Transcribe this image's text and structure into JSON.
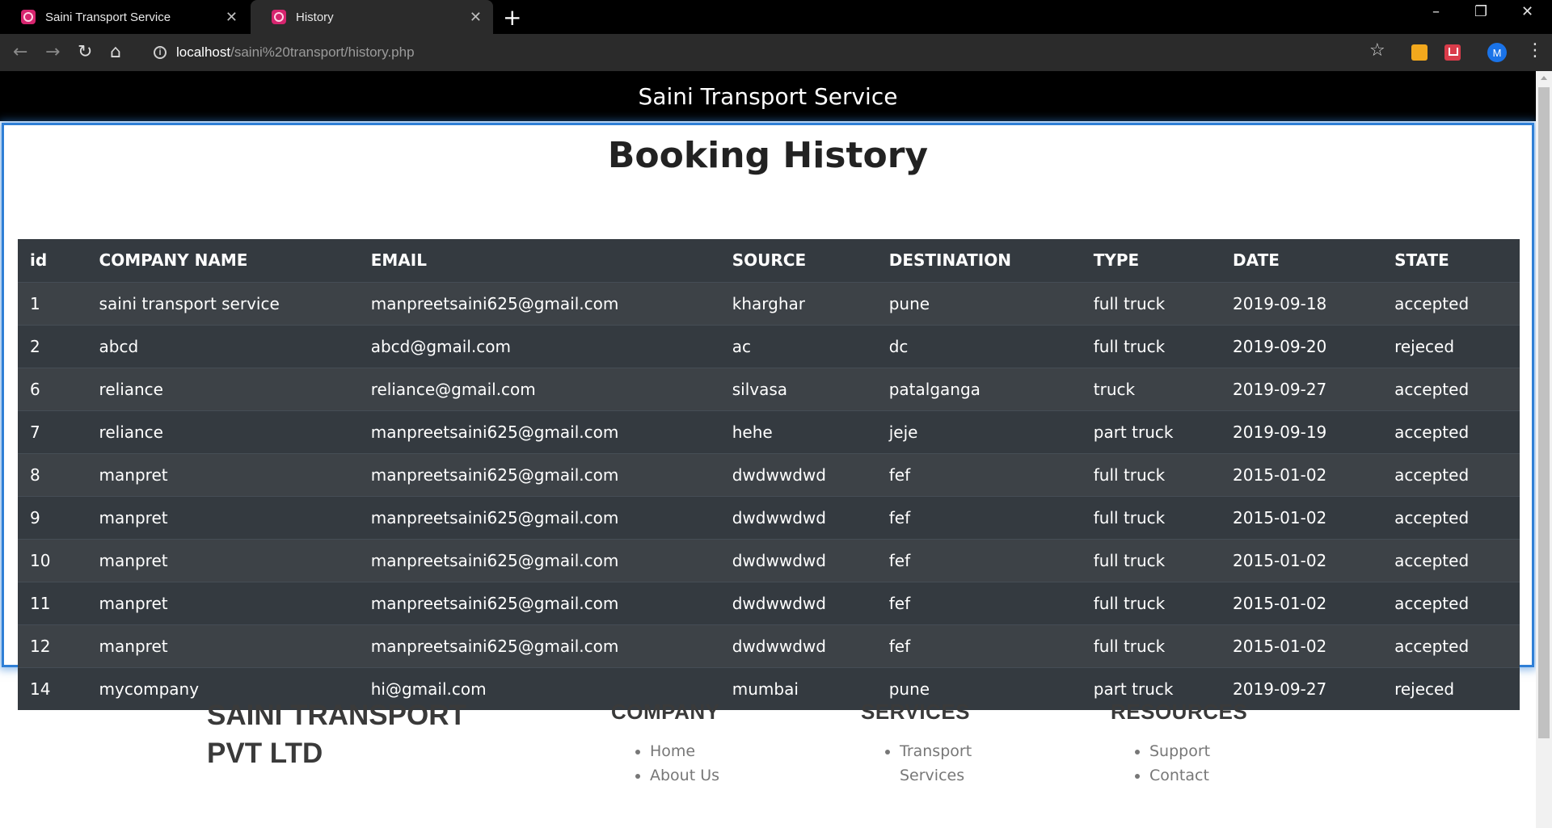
{
  "browser": {
    "tabs": [
      {
        "title": "Saini Transport Service",
        "active": false
      },
      {
        "title": "History",
        "active": true
      }
    ],
    "url_host": "localhost",
    "url_path": "/saini%20transport/history.php",
    "profile_initial": "M",
    "colors": {
      "tab_favicon": "#d6246e",
      "profile": "#1a73e8"
    }
  },
  "site": {
    "header_title": "Saini Transport Service"
  },
  "history": {
    "title": "Booking History",
    "columns": [
      "id",
      "COMPANY NAME",
      "EMAIL",
      "SOURCE",
      "DESTINATION",
      "TYPE",
      "DATE",
      "STATE"
    ],
    "rows": [
      [
        "1",
        "saini transport service",
        "manpreetsaini625@gmail.com",
        "kharghar",
        "pune",
        "full truck",
        "2019-09-18",
        "accepted"
      ],
      [
        "2",
        "abcd",
        "abcd@gmail.com",
        "ac",
        "dc",
        "full truck",
        "2019-09-20",
        "rejeced"
      ],
      [
        "6",
        "reliance",
        "reliance@gmail.com",
        "silvasa",
        "patalganga",
        "truck",
        "2019-09-27",
        "accepted"
      ],
      [
        "7",
        "reliance",
        "manpreetsaini625@gmail.com",
        "hehe",
        "jeje",
        "part truck",
        "2019-09-19",
        "accepted"
      ],
      [
        "8",
        "manpret",
        "manpreetsaini625@gmail.com",
        "dwdwwdwd",
        "fef",
        "full truck",
        "2015-01-02",
        "accepted"
      ],
      [
        "9",
        "manpret",
        "manpreetsaini625@gmail.com",
        "dwdwwdwd",
        "fef",
        "full truck",
        "2015-01-02",
        "accepted"
      ],
      [
        "10",
        "manpret",
        "manpreetsaini625@gmail.com",
        "dwdwwdwd",
        "fef",
        "full truck",
        "2015-01-02",
        "accepted"
      ],
      [
        "11",
        "manpret",
        "manpreetsaini625@gmail.com",
        "dwdwwdwd",
        "fef",
        "full truck",
        "2015-01-02",
        "accepted"
      ],
      [
        "12",
        "manpret",
        "manpreetsaini625@gmail.com",
        "dwdwwdwd",
        "fef",
        "full truck",
        "2015-01-02",
        "accepted"
      ],
      [
        "14",
        "mycompany",
        "hi@gmail.com",
        "mumbai",
        "pune",
        "part truck",
        "2019-09-27",
        "rejeced"
      ]
    ]
  },
  "footer": {
    "brand": "SAINI TRANSPORT PVT LTD",
    "columns": [
      {
        "heading": "COMPANY",
        "items": [
          "Home",
          "About Us"
        ]
      },
      {
        "heading": "SERVICES",
        "items": [
          "Transport Services"
        ]
      },
      {
        "heading": "RESOURCES",
        "items": [
          "Support",
          "Contact"
        ]
      }
    ]
  }
}
